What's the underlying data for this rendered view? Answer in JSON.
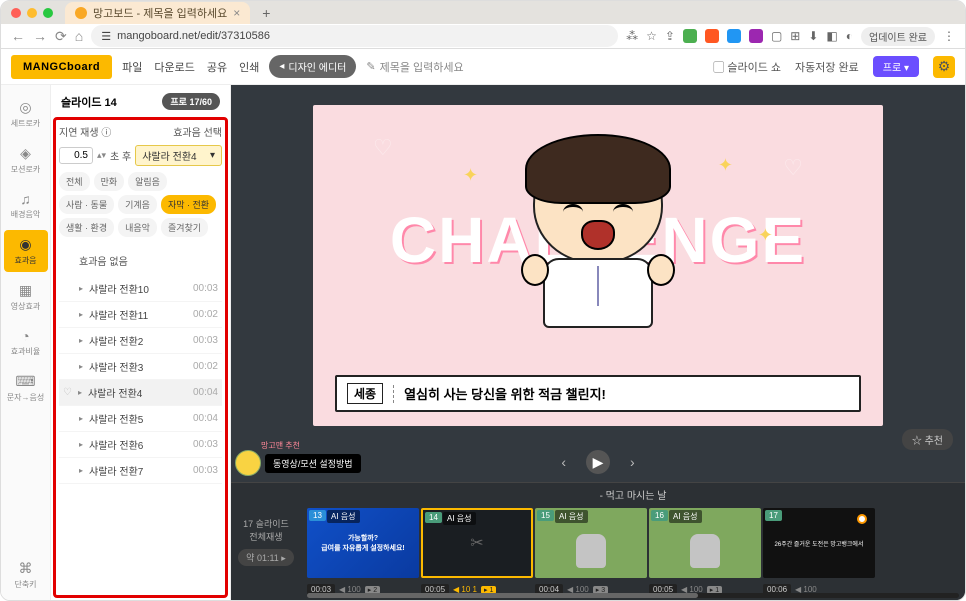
{
  "browser": {
    "tab_title": "망고보드 - 제목을 입력하세요",
    "url": "mangoboard.net/edit/37310586",
    "update_button": "업데이트 완료"
  },
  "header": {
    "logo": "MANGCboard",
    "menu": {
      "file": "파일",
      "download": "다운로드",
      "share": "공유",
      "print": "인쇄"
    },
    "design_editor": "디자인 에디터",
    "title_placeholder": "제목을 입력하세요",
    "slideshow": "슬라이드 쇼",
    "autosave": "자동저장 완료",
    "pro": "프로"
  },
  "rail": {
    "setloca": "세트로카",
    "motionloca": "모션로카",
    "bgm": "배경음악",
    "sfx": "효과음",
    "videosfx": "영상효과",
    "sfxcut": "효과비율",
    "tts": "문자→음성",
    "shortcut": "단축키"
  },
  "panel": {
    "slide_label": "슬라이드 14",
    "pro_count": "프로 17/60",
    "delay_label": "지연 재생",
    "effect_select_label": "효과음 선택",
    "delay_value": "0.5",
    "delay_unit": "초 후",
    "selected_effect": "샤랄라 전환4",
    "categories": {
      "all": "전체",
      "cartoon": "만화",
      "alert": "알림음",
      "person_animal": "사람 · 동물",
      "machine": "기계음",
      "caption_transition": "자막 · 전환",
      "life_env": "생활 · 환경",
      "content": "내음악",
      "favorite": "즐겨찾기"
    },
    "no_effect": "효과음 없음",
    "effects": [
      {
        "name": "샤랄라 전환10",
        "dur": "00:03",
        "sel": false
      },
      {
        "name": "샤랄라 전환11",
        "dur": "00:02",
        "sel": false
      },
      {
        "name": "샤랄라 전환2",
        "dur": "00:03",
        "sel": false
      },
      {
        "name": "샤랄라 전환3",
        "dur": "00:02",
        "sel": false
      },
      {
        "name": "샤랄라 전환4",
        "dur": "00:04",
        "sel": true
      },
      {
        "name": "샤랄라 전환5",
        "dur": "00:04",
        "sel": false
      },
      {
        "name": "샤랄라 전환6",
        "dur": "00:03",
        "sel": false
      },
      {
        "name": "샤랄라 전환7",
        "dur": "00:03",
        "sel": false
      }
    ]
  },
  "slide": {
    "big_text": "CHALLENGE",
    "caption_tag": "세종",
    "caption_text": "열심히 사는 당신을 위한 적금 챌린지!"
  },
  "canvas": {
    "recommend": "☆ 추천",
    "mascot_sub": "망고맨 추천",
    "mascot_label": "동영상/모션 설정방법"
  },
  "timeline": {
    "left_label": "17 슬라이드\n전체재생",
    "duration_pill": "약 01:11 ▸",
    "header": "- 먹고 마시는 날",
    "thumbs": [
      {
        "num": "13",
        "tag": "AI 음성",
        "type": "blue",
        "txt": "가능할까?\n급여를 자유롭게 설정하세요!",
        "dur": "00:03",
        "vol": "◀ 100",
        "aud": "2"
      },
      {
        "num": "14",
        "tag": "AI 음성",
        "type": "dark",
        "sel": true,
        "dur": "00:05",
        "vol": "◀ 10 1",
        "aud": "1",
        "vy": true
      },
      {
        "num": "15",
        "tag": "AI 음성",
        "type": "green",
        "dur": "00:04",
        "vol": "◀ 100",
        "aud": "3"
      },
      {
        "num": "16",
        "tag": "AI 음성",
        "type": "green",
        "dur": "00:05",
        "vol": "◀ 100",
        "aud": "1"
      },
      {
        "num": "17",
        "tag": "",
        "type": "final",
        "txt": "26주간 즐거운 도전은 망고뱅크에서",
        "dur": "00:06",
        "vol": "◀ 100",
        "aud": ""
      }
    ]
  }
}
